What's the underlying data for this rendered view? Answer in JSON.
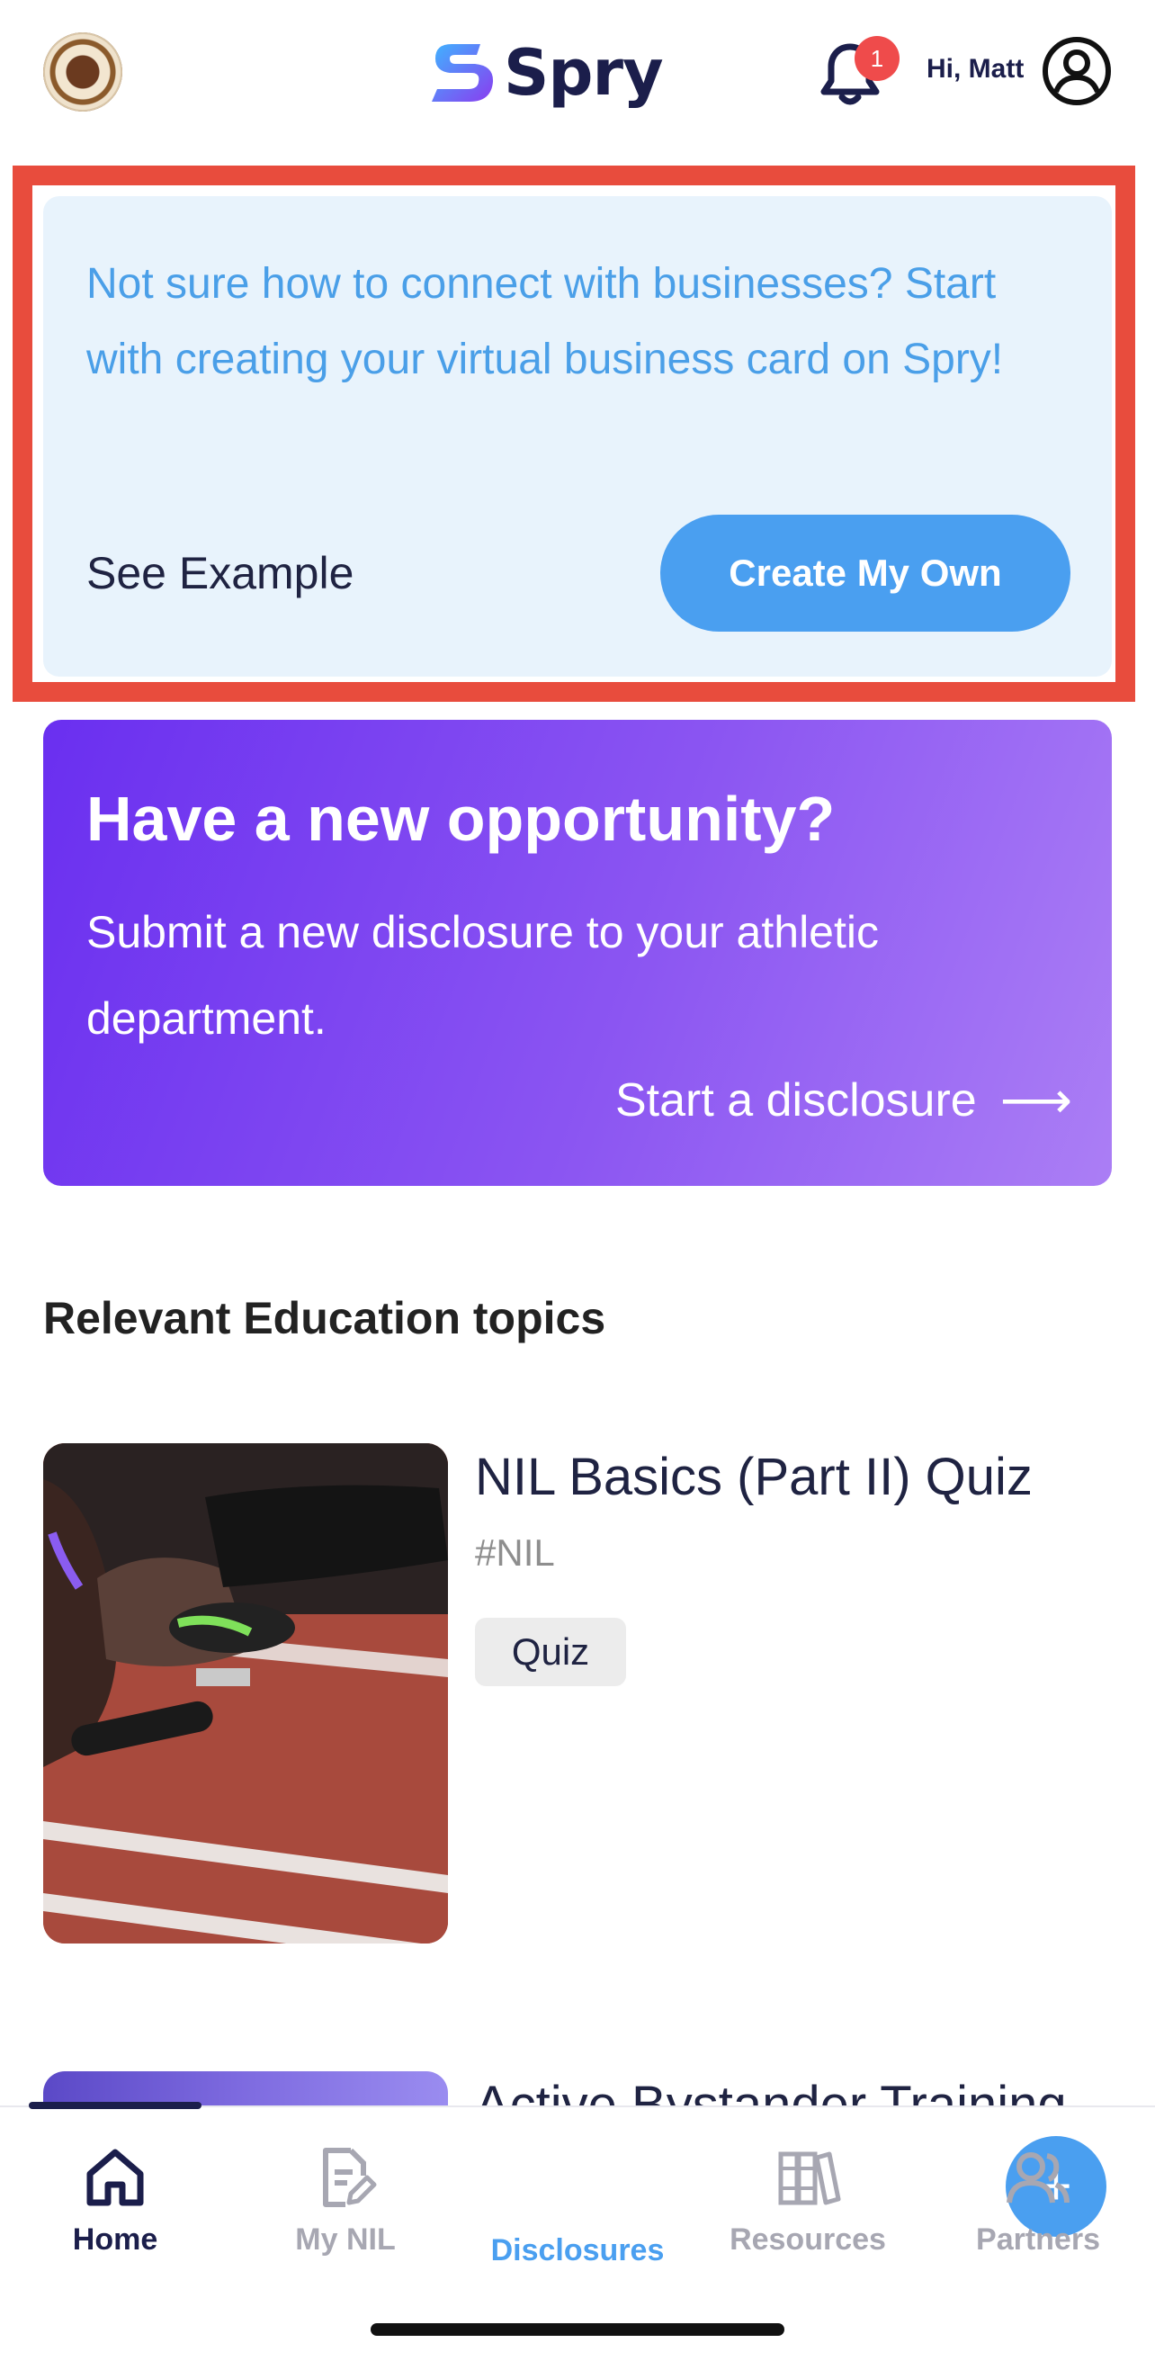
{
  "header": {
    "app_name": "Spry",
    "greeting": "Hi, Matt",
    "notification_count": "1"
  },
  "business_card_prompt": {
    "message": "Not sure how to connect with businesses? Start with creating your virtual business card on Spry!",
    "see_example_label": "See Example",
    "create_button_label": "Create My Own"
  },
  "opportunity": {
    "title": "Have a new opportunity?",
    "description": "Submit a new disclosure to your athletic department.",
    "link_label": "Start a disclosure",
    "arrow": "⟶"
  },
  "education": {
    "section_title": "Relevant Education topics",
    "items": [
      {
        "title": "NIL Basics (Part II) Quiz",
        "tag": "#NIL",
        "type": "Quiz"
      },
      {
        "title": "Active Bystander Training"
      }
    ]
  },
  "tabbar": {
    "tabs": [
      {
        "label": "Home",
        "icon": "home-icon"
      },
      {
        "label": "My NIL",
        "icon": "document-edit-icon"
      },
      {
        "label": "Disclosures",
        "icon": "plus-icon"
      },
      {
        "label": "Resources",
        "icon": "books-icon"
      },
      {
        "label": "Partners",
        "icon": "people-icon"
      }
    ],
    "fab_symbol": "+"
  },
  "colors": {
    "accent_blue": "#4a9ff0",
    "highlight_red": "#e84c3d",
    "navy": "#1b1e4b",
    "purple_start": "#6a2ff0",
    "purple_end": "#ab7ef5"
  }
}
